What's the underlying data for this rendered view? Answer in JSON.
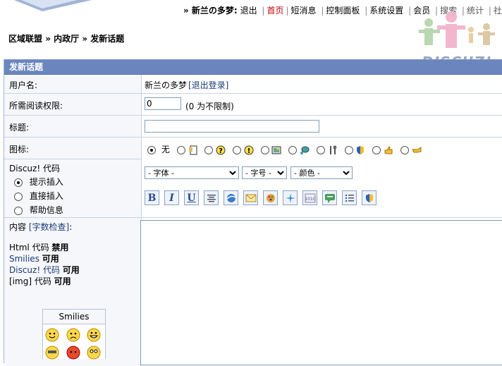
{
  "topnav": {
    "user_prefix": "» 新兰の多梦:",
    "logout": "退出",
    "items": [
      "首页",
      "短消息",
      "控制面板",
      "系统设置",
      "会员",
      "搜索",
      "统计",
      "社区"
    ]
  },
  "logo": {
    "text": "DISCUZ!"
  },
  "breadcrumb": {
    "items": [
      "区域联盟",
      "内政厅",
      "发新话题"
    ]
  },
  "form": {
    "title": "发新话题",
    "username": {
      "label": "用户名:",
      "value": "新兰の多梦",
      "logout_link": "[退出登录]"
    },
    "read_perm": {
      "label": "所需阅读权限:",
      "value": "0",
      "hint": "(0 为不限制)"
    },
    "subject": {
      "label": "标题:",
      "value": ""
    },
    "icon": {
      "label": "图标:",
      "none_label": "无",
      "options": [
        "page-icon",
        "question-icon",
        "exclamation-icon",
        "picture-icon",
        "thought-icon",
        "tools-icon",
        "shield-icon",
        "thumbs-up-icon",
        "hand-point-icon"
      ]
    },
    "discuz_code": {
      "label": "Discuz! 代码",
      "modes": [
        "提示插入",
        "直接插入",
        "帮助信息"
      ],
      "selected_mode": 0,
      "font_select": "- 字体 -",
      "size_select": "- 字号 -",
      "color_select": "- 颜色 -",
      "toolbar": [
        "bold-icon",
        "italic-icon",
        "underline-icon",
        "center-align-icon",
        "url-icon",
        "email-icon",
        "image-icon",
        "flash-icon",
        "code-icon",
        "quote-icon",
        "list-icon",
        "hide-icon"
      ]
    },
    "content": {
      "label_prefix": "内容",
      "label_link": "[字数检查]",
      "label_suffix": ":",
      "html_code": "Html 代码",
      "html_status": "禁用",
      "smilies": "Smilies",
      "smilies_status": "可用",
      "discuz_code": "Discuz! 代码",
      "discuz_status": "可用",
      "img_code": "[img] 代码",
      "img_status": "可用"
    },
    "smilies_box": {
      "title": "Smilies"
    }
  }
}
